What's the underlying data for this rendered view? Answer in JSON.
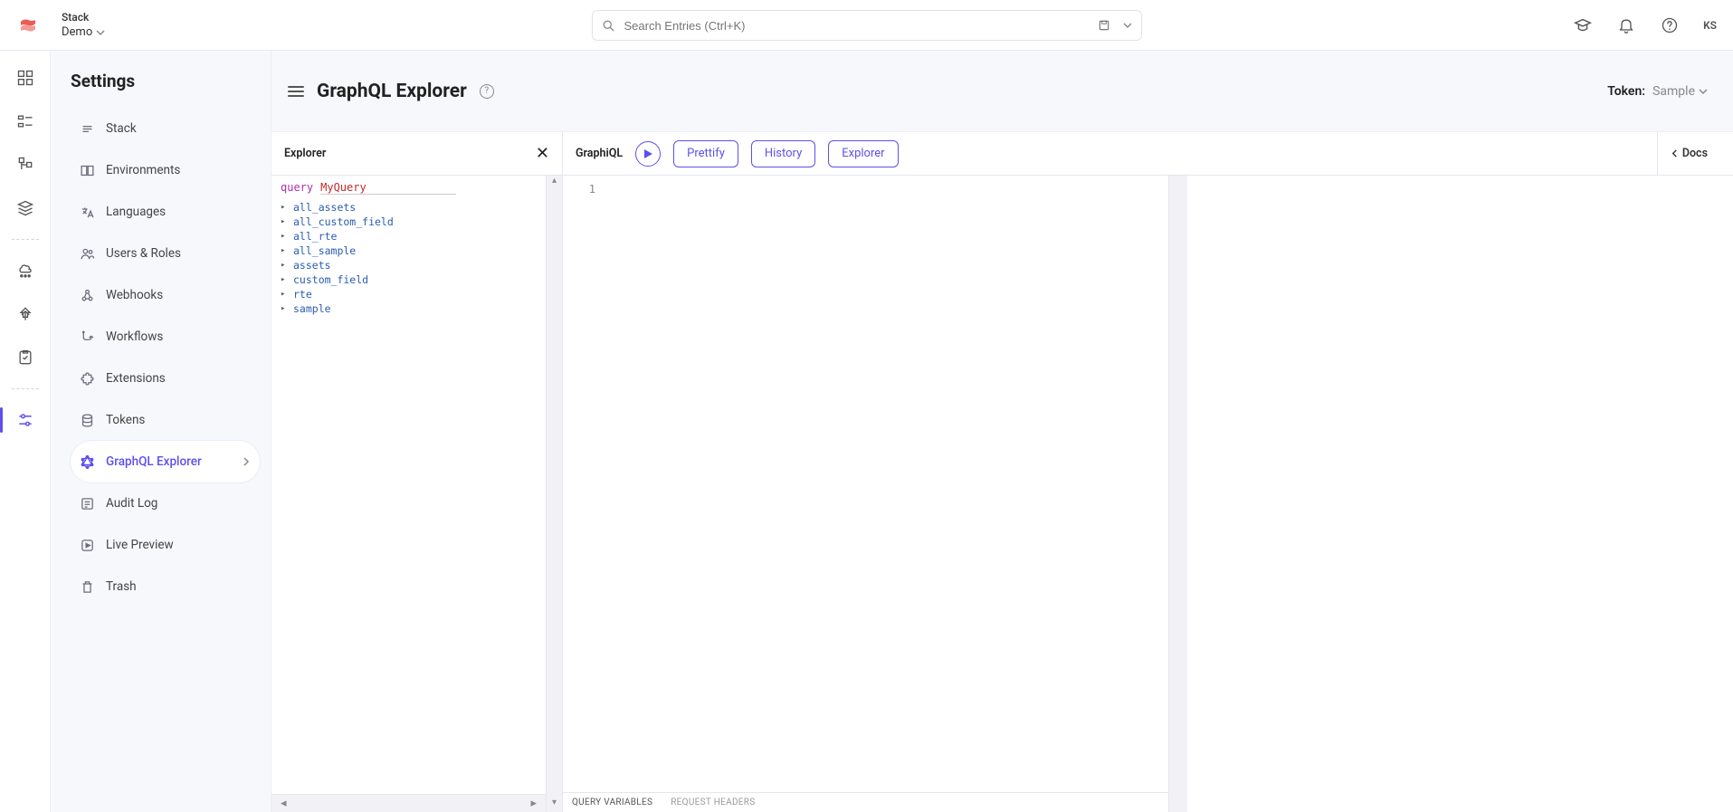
{
  "header": {
    "stack_label": "Stack",
    "stack_value": "Demo",
    "search_placeholder": "Search Entries (Ctrl+K)",
    "avatar_initials": "KS"
  },
  "settings": {
    "title": "Settings",
    "items": [
      {
        "label": "Stack"
      },
      {
        "label": "Environments"
      },
      {
        "label": "Languages"
      },
      {
        "label": "Users & Roles"
      },
      {
        "label": "Webhooks"
      },
      {
        "label": "Workflows"
      },
      {
        "label": "Extensions"
      },
      {
        "label": "Tokens"
      },
      {
        "label": "GraphQL Explorer"
      },
      {
        "label": "Audit Log"
      },
      {
        "label": "Live Preview"
      },
      {
        "label": "Trash"
      }
    ]
  },
  "page": {
    "title": "GraphQL Explorer",
    "token_label": "Token:",
    "token_value": "Sample"
  },
  "explorer": {
    "panel_title": "Explorer",
    "query_keyword": "query",
    "query_name": "MyQuery",
    "tree": [
      "all_assets",
      "all_custom_field",
      "all_rte",
      "all_sample",
      "assets",
      "custom_field",
      "rte",
      "sample"
    ]
  },
  "graphiql": {
    "brand": "GraphiQL",
    "prettify": "Prettify",
    "history": "History",
    "explorer": "Explorer",
    "docs": "Docs",
    "line_number": "1",
    "query_variables_tab": "QUERY VARIABLES",
    "request_headers_tab": "REQUEST HEADERS"
  }
}
